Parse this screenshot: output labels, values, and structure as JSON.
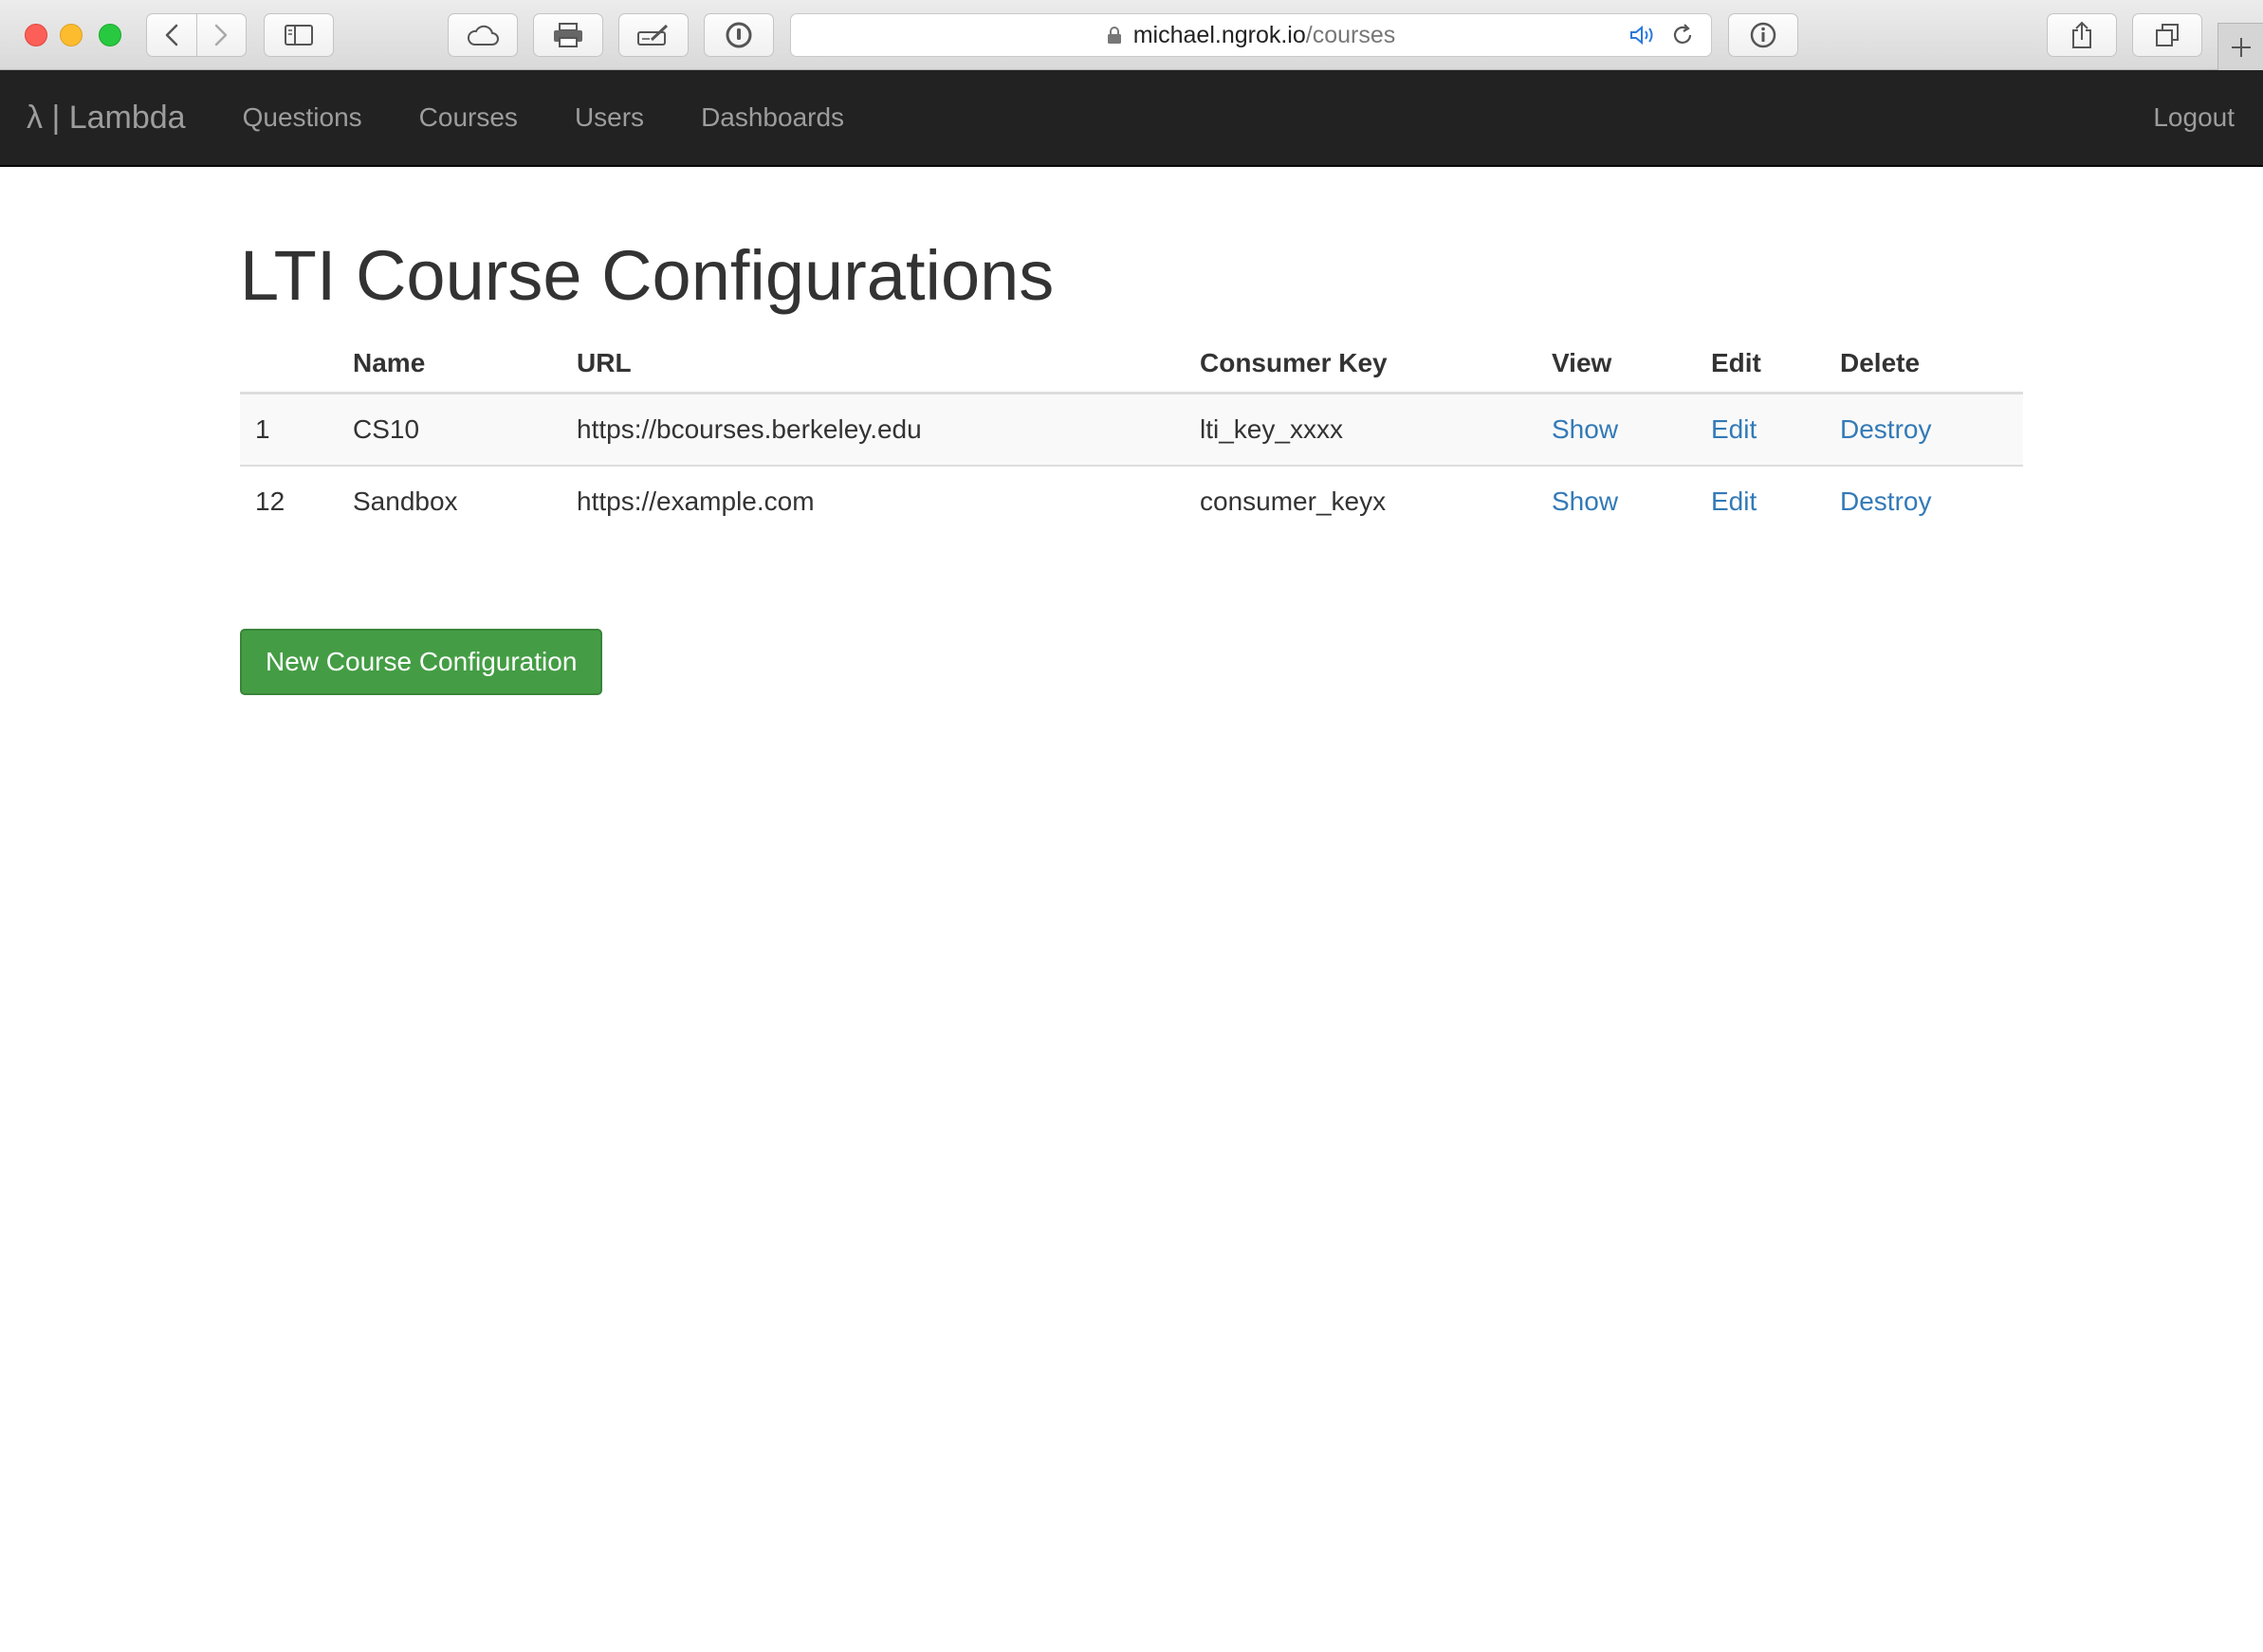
{
  "browser": {
    "url_host": "michael.ngrok.io",
    "url_path": "/courses",
    "icons": [
      "back-icon",
      "forward-icon",
      "sidebar-icon",
      "cloud-icon",
      "print-icon",
      "markup-icon",
      "password-icon",
      "lock-icon",
      "audio-icon",
      "reload-icon",
      "info-icon",
      "share-icon",
      "tabs-icon",
      "new-tab-icon"
    ]
  },
  "navbar": {
    "brand": "λ | Lambda",
    "links": [
      "Questions",
      "Courses",
      "Users",
      "Dashboards"
    ],
    "logout": "Logout"
  },
  "page": {
    "title": "LTI Course Configurations",
    "table": {
      "headers": [
        "",
        "Name",
        "URL",
        "Consumer Key",
        "View",
        "Edit",
        "Delete"
      ],
      "rows": [
        {
          "id": "1",
          "name": "CS10",
          "url": "https://bcourses.berkeley.edu",
          "consumer_key": "lti_key_xxxx",
          "view": "Show",
          "edit": "Edit",
          "delete": "Destroy"
        },
        {
          "id": "12",
          "name": "Sandbox",
          "url": "https://example.com",
          "consumer_key": "consumer_keyx",
          "view": "Show",
          "edit": "Edit",
          "delete": "Destroy"
        }
      ]
    },
    "new_button": "New Course Configuration"
  },
  "colors": {
    "navbar_bg": "#222222",
    "link": "#337ab7",
    "button_success": "#449d44"
  }
}
